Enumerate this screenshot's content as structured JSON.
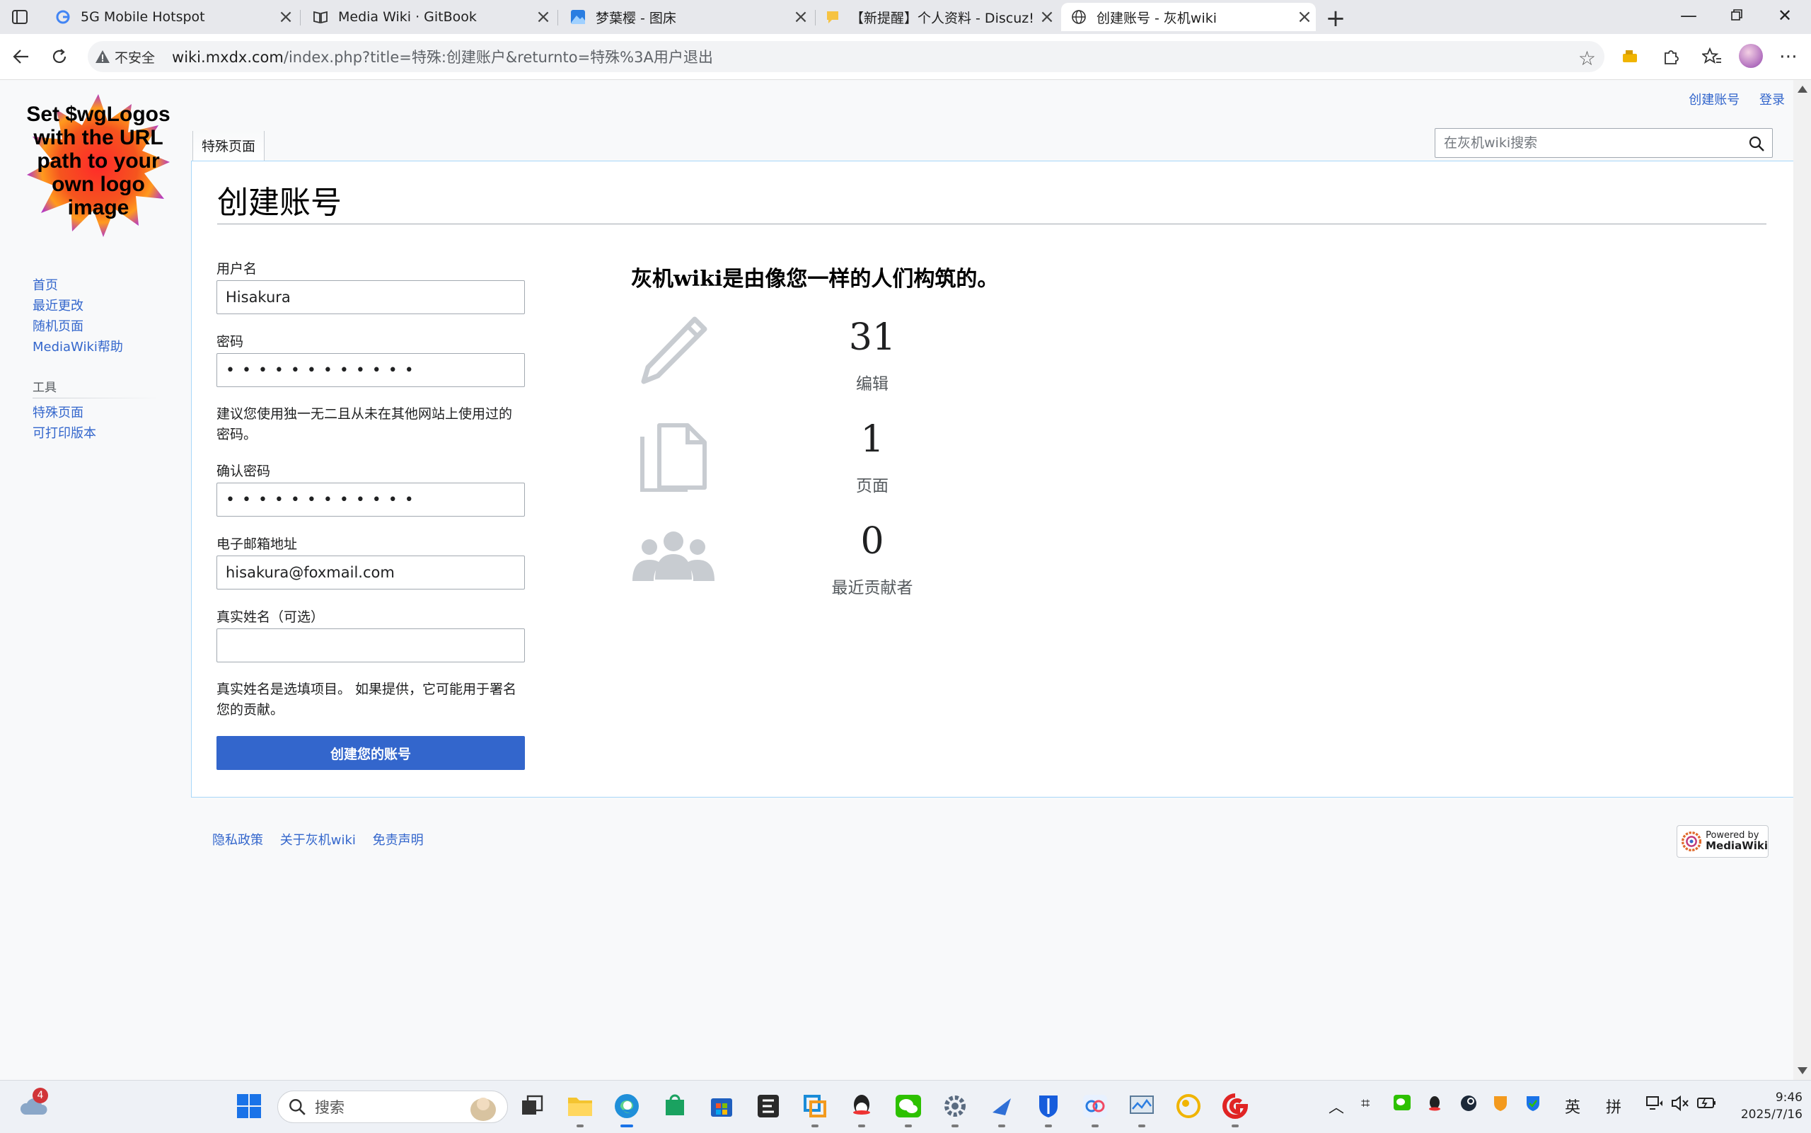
{
  "browser": {
    "tabs": [
      {
        "title": "5G Mobile Hotspot"
      },
      {
        "title": "Media Wiki · GitBook"
      },
      {
        "title": "梦葉樱 - 图床"
      },
      {
        "title": "【新提醒】个人资料 - Discuz! Bo"
      },
      {
        "title": "创建账号 - 灰机wiki"
      }
    ],
    "security_label": "不安全",
    "url_host": "wiki.mxdx.com",
    "url_rest": "/index.php?title=特殊:创建账户&returnto=特殊%3A用户退出"
  },
  "wiki": {
    "logo_text": "Set $wgLogos with the URL path to your own logo image",
    "personal": {
      "create_account": "创建账号",
      "login": "登录"
    },
    "special_tab": "特殊页面",
    "search_placeholder": "在灰机wiki搜索",
    "sidebar": {
      "navigation": [
        {
          "label": "首页"
        },
        {
          "label": "最近更改"
        },
        {
          "label": "随机页面"
        },
        {
          "label": "MediaWiki帮助"
        }
      ],
      "tools_heading": "工具",
      "tools": [
        {
          "label": "特殊页面"
        },
        {
          "label": "可打印版本"
        }
      ]
    },
    "page_title": "创建账号",
    "form": {
      "username_label": "用户名",
      "username_value": "Hisakura",
      "password_label": "密码",
      "password_value": "••••••••••••",
      "password_hint": "建议您使用独一无二且从未在其他网站上使用过的密码。",
      "confirm_label": "确认密码",
      "confirm_value": "••••••••••••",
      "email_label": "电子邮箱地址",
      "email_value": "hisakura@foxmail.com",
      "realname_label": "真实姓名（可选）",
      "realname_value": "",
      "realname_hint": "真实姓名是选填项目。 如果提供，它可能用于署名您的贡献。",
      "submit_label": "创建您的账号"
    },
    "promo": {
      "headline": "灰机wiki是由像您一样的人们构筑的。",
      "stats": [
        {
          "icon": "pencil-icon",
          "value": "31",
          "label": "编辑"
        },
        {
          "icon": "document-icon",
          "value": "1",
          "label": "页面"
        },
        {
          "icon": "people-icon",
          "value": "0",
          "label": "最近贡献者"
        }
      ]
    },
    "footer": {
      "links": [
        {
          "label": "隐私政策"
        },
        {
          "label": "关于灰机wiki"
        },
        {
          "label": "免责声明"
        }
      ],
      "powered_line1": "Powered by",
      "powered_line2": "MediaWiki"
    }
  },
  "taskbar": {
    "weather_badge": "4",
    "search_placeholder": "搜索",
    "ime_lang": "英",
    "ime_mode": "拼",
    "time": "9:46",
    "date": "2025/7/16"
  }
}
